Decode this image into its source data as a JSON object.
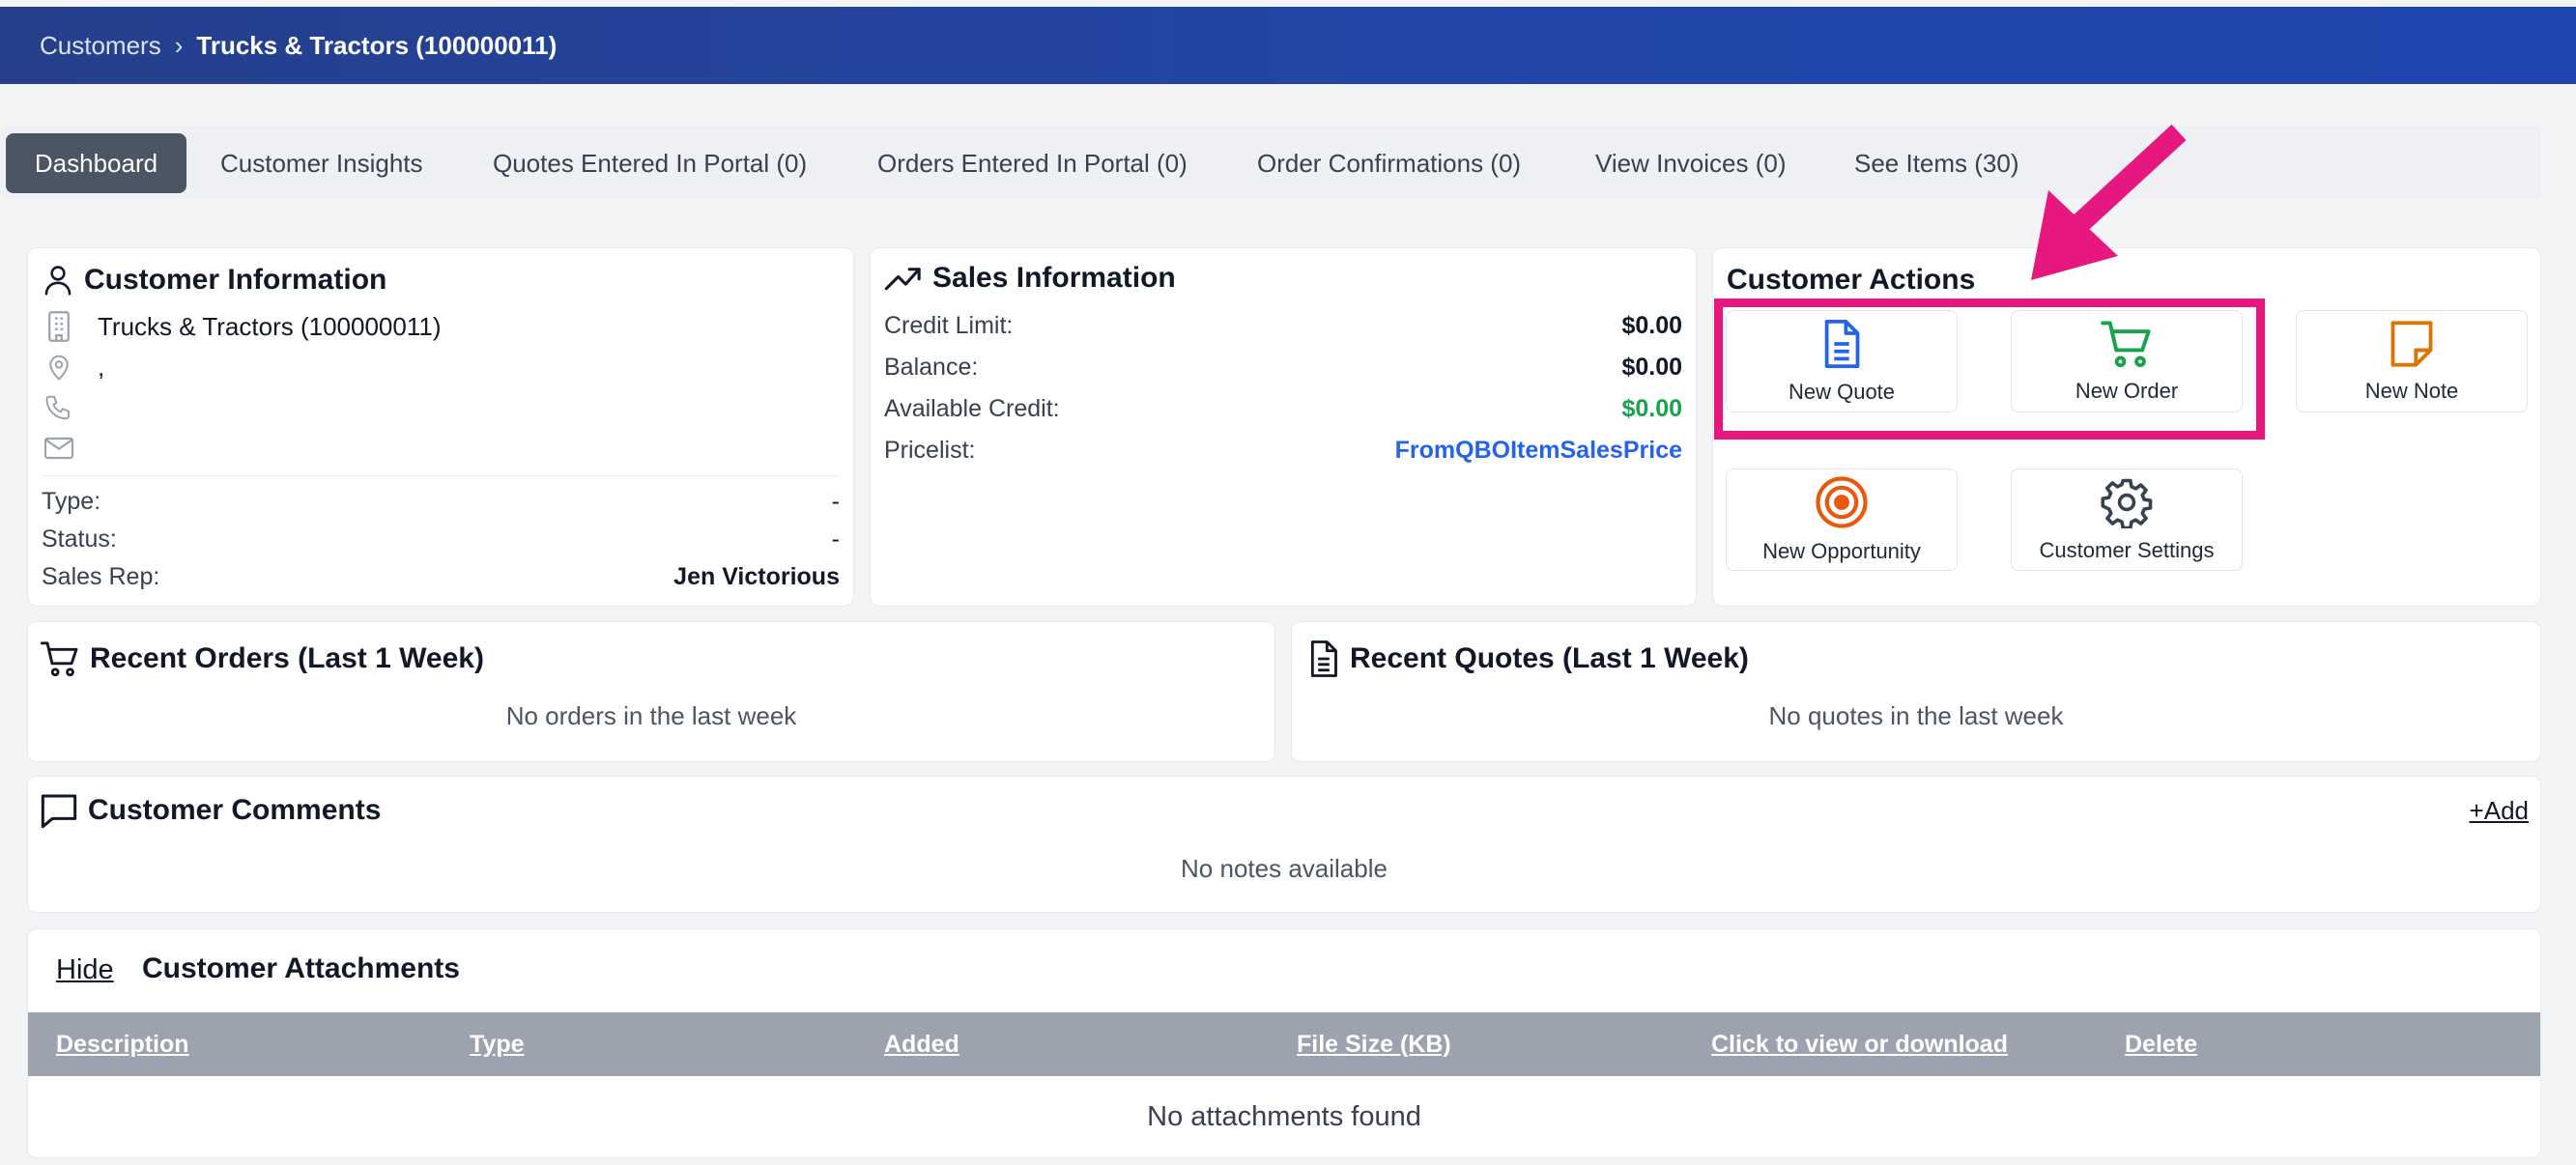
{
  "breadcrumb": {
    "parent": "Customers",
    "separator": "›",
    "current": "Trucks & Tractors (100000011)"
  },
  "tabs": [
    {
      "label": "Dashboard",
      "active": true
    },
    {
      "label": "Customer Insights",
      "active": false
    },
    {
      "label": "Quotes Entered In Portal (0)",
      "active": false
    },
    {
      "label": "Orders Entered In Portal (0)",
      "active": false
    },
    {
      "label": "Order Confirmations (0)",
      "active": false
    },
    {
      "label": "View Invoices (0)",
      "active": false
    },
    {
      "label": "See Items (30)",
      "active": false
    }
  ],
  "customer_info": {
    "title": "Customer Information",
    "name": "Trucks & Tractors (100000011)",
    "address": ",",
    "phone": "",
    "email": "",
    "type_label": "Type:",
    "type_value": "-",
    "status_label": "Status:",
    "status_value": "-",
    "sales_rep_label": "Sales Rep:",
    "sales_rep_value": "Jen Victorious"
  },
  "sales_info": {
    "title": "Sales Information",
    "credit_limit_label": "Credit Limit:",
    "credit_limit_value": "$0.00",
    "balance_label": "Balance:",
    "balance_value": "$0.00",
    "available_credit_label": "Available Credit:",
    "available_credit_value": "$0.00",
    "pricelist_label": "Pricelist:",
    "pricelist_value": "FromQBOItemSalesPrice"
  },
  "customer_actions": {
    "title": "Customer Actions",
    "new_quote": "New Quote",
    "new_order": "New Order",
    "new_note": "New Note",
    "new_opportunity": "New Opportunity",
    "customer_settings": "Customer Settings"
  },
  "recent_orders": {
    "title": "Recent Orders (Last 1 Week)",
    "empty": "No orders in the last week"
  },
  "recent_quotes": {
    "title": "Recent Quotes (Last 1 Week)",
    "empty": "No quotes in the last week"
  },
  "comments": {
    "title": "Customer Comments",
    "add_label": "+Add",
    "empty": "No notes available"
  },
  "attachments": {
    "hide_label": "Hide",
    "title": "Customer Attachments",
    "columns": [
      "Description",
      "Type",
      "Added",
      "File Size (KB)",
      "Click to view or download",
      "Delete"
    ],
    "empty": "No attachments found"
  },
  "colors": {
    "header": "#2246a8",
    "highlight": "#e6177e",
    "quote_icon": "#2563eb",
    "order_icon": "#16a34a",
    "note_icon": "#d97706",
    "opportunity_icon": "#ea580c",
    "settings_icon": "#374151"
  }
}
